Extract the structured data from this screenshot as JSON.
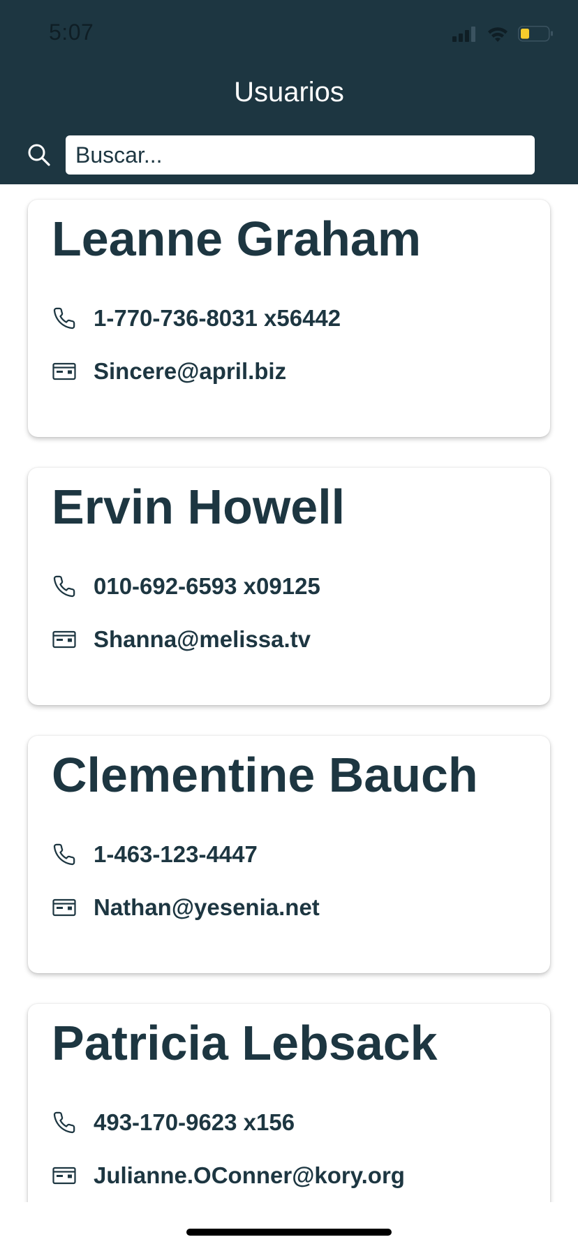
{
  "status_bar": {
    "time": "5:07"
  },
  "header": {
    "title": "Usuarios"
  },
  "search": {
    "placeholder": "Buscar..."
  },
  "icons": {
    "search": "search-icon",
    "phone": "phone-icon",
    "email": "card-icon",
    "signal": "signal-icon",
    "wifi": "wifi-icon",
    "battery": "battery-icon"
  },
  "colors": {
    "header_bg": "#1d3641",
    "text_primary": "#1d3641",
    "battery_level": "#f5cc2c"
  },
  "users": [
    {
      "name": "Leanne Graham",
      "phone": "1-770-736-8031 x56442",
      "email": "Sincere@april.biz"
    },
    {
      "name": "Ervin Howell",
      "phone": "010-692-6593 x09125",
      "email": "Shanna@melissa.tv"
    },
    {
      "name": "Clementine Bauch",
      "phone": "1-463-123-4447",
      "email": "Nathan@yesenia.net"
    },
    {
      "name": "Patricia Lebsack",
      "phone": "493-170-9623 x156",
      "email": "Julianne.OConner@kory.org"
    }
  ]
}
